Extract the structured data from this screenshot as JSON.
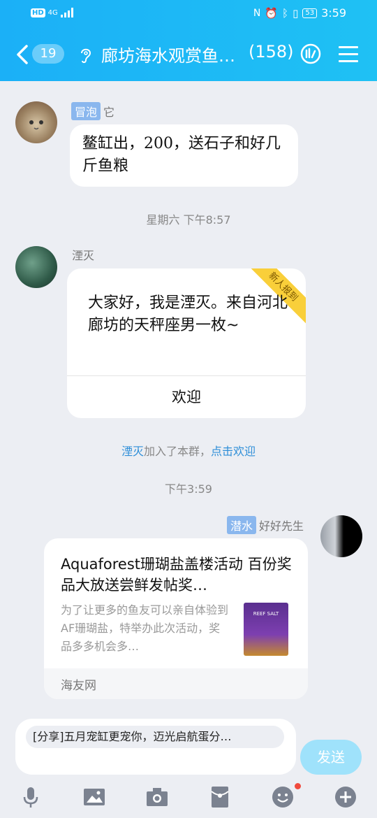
{
  "status_bar": {
    "left_icons": "HD 4G signal",
    "network": "4G",
    "battery": "53",
    "time": "3:59"
  },
  "header": {
    "unread_count": "19",
    "title": "廊坊海水观赏鱼…",
    "member_count": "(158)"
  },
  "messages": [
    {
      "tag": "冒泡",
      "sender": "它",
      "text": "鳌缸出，200，送石子和好几斤鱼粮"
    }
  ],
  "timestamps": {
    "t1": "星期六 下午8:57",
    "t2": "下午3:59"
  },
  "intro_card": {
    "sender": "湮灭",
    "ribbon": "新人报到",
    "text": "大家好，我是湮灭。来自河北廊坊的天秤座男一枚~",
    "action": "欢迎"
  },
  "system": {
    "name": "湮灭",
    "joined": "加入了本群，",
    "link": "点击欢迎"
  },
  "share_msg": {
    "tag": "潜水",
    "sender": "好好先生",
    "title": "Aquaforest珊瑚盐盖楼活动 百份奖品大放送尝鲜发帖奖…",
    "desc": "为了让更多的鱼友可以亲自体验到AF珊瑚盐，特举办此次活动，奖品多多机会多…",
    "image_text": "REEF SALT",
    "source": "海友网"
  },
  "composer": {
    "draft": "[分享]五月宠缸更宠你，迈光启航蛋分…",
    "send_label": "发送"
  },
  "colors": {
    "header": "#1bb0f7",
    "link": "#2f8fd8",
    "bg": "#eceef3"
  }
}
